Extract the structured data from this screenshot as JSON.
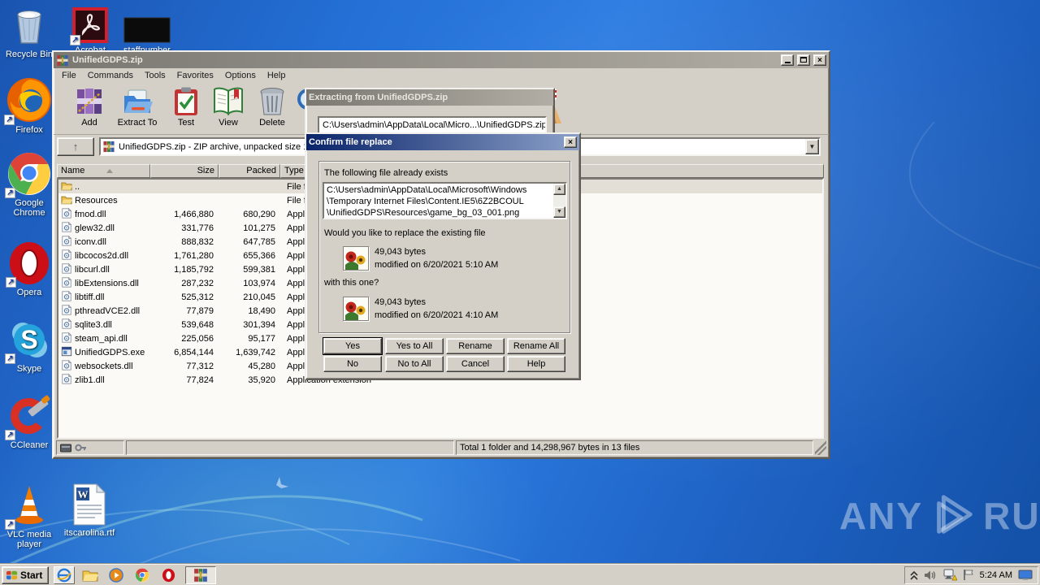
{
  "colors": {
    "desktop_blue": "#2470d6",
    "classic_gray": "#d4d0c8",
    "active_title_start": "#0a246a",
    "active_title_end": "#8ba0c8",
    "inactive_title_start": "#7b7872",
    "inactive_title_end": "#b2aea5"
  },
  "desktop": {
    "icons": {
      "recycle_bin": "Recycle Bin",
      "acrobat": "Acrobat",
      "staffnumber": "staffnumber",
      "firefox": "Firefox",
      "chrome": "Google Chrome",
      "opera": "Opera",
      "skype": "Skype",
      "ccleaner": "CCleaner",
      "vlc": "VLC media player",
      "rtf": "itscarolina.rtf"
    },
    "watermark": {
      "left": "ANY",
      "right": "RUN"
    }
  },
  "winrar": {
    "title": "UnifiedGDPS.zip",
    "window_buttons": [
      "minimize",
      "maximize",
      "close"
    ],
    "menu": [
      "File",
      "Commands",
      "Tools",
      "Favorites",
      "Options",
      "Help"
    ],
    "toolbar": [
      "Add",
      "Extract To",
      "Test",
      "View",
      "Delete"
    ],
    "address": "UnifiedGDPS.zip - ZIP archive, unpacked size 18",
    "columns": {
      "name": "Name",
      "size": "Size",
      "packed": "Packed",
      "type": "Type"
    },
    "rows": [
      {
        "icon": "folder",
        "name": "..",
        "size": "",
        "packed": "",
        "type": "File folder",
        "up": true
      },
      {
        "icon": "folder",
        "name": "Resources",
        "size": "",
        "packed": "",
        "type": "File folder"
      },
      {
        "icon": "dll",
        "name": "fmod.dll",
        "size": "1,466,880",
        "packed": "680,290",
        "type": "Application extension"
      },
      {
        "icon": "dll",
        "name": "glew32.dll",
        "size": "331,776",
        "packed": "101,275",
        "type": "Application extension"
      },
      {
        "icon": "dll",
        "name": "iconv.dll",
        "size": "888,832",
        "packed": "647,785",
        "type": "Application extension"
      },
      {
        "icon": "dll",
        "name": "libcocos2d.dll",
        "size": "1,761,280",
        "packed": "655,366",
        "type": "Application extension"
      },
      {
        "icon": "dll",
        "name": "libcurl.dll",
        "size": "1,185,792",
        "packed": "599,381",
        "type": "Application extension"
      },
      {
        "icon": "dll",
        "name": "libExtensions.dll",
        "size": "287,232",
        "packed": "103,974",
        "type": "Application extension"
      },
      {
        "icon": "dll",
        "name": "libtiff.dll",
        "size": "525,312",
        "packed": "210,045",
        "type": "Application extension"
      },
      {
        "icon": "dll",
        "name": "pthreadVCE2.dll",
        "size": "77,879",
        "packed": "18,490",
        "type": "Application extension"
      },
      {
        "icon": "dll",
        "name": "sqlite3.dll",
        "size": "539,648",
        "packed": "301,394",
        "type": "Application extension"
      },
      {
        "icon": "dll",
        "name": "steam_api.dll",
        "size": "225,056",
        "packed": "95,177",
        "type": "Application extension"
      },
      {
        "icon": "exe",
        "name": "UnifiedGDPS.exe",
        "size": "6,854,144",
        "packed": "1,639,742",
        "type": "Application"
      },
      {
        "icon": "dll",
        "name": "websockets.dll",
        "size": "77,312",
        "packed": "45,280",
        "type": "Application extension"
      },
      {
        "icon": "dll",
        "name": "zlib1.dll",
        "size": "77,824",
        "packed": "35,920",
        "type": "Application extension"
      }
    ],
    "status_total": "Total 1 folder and 14,298,967 bytes in 13 files"
  },
  "extract_dialog": {
    "title": "Extracting from UnifiedGDPS.zip",
    "path": "C:\\Users\\admin\\AppData\\Local\\Micro...\\UnifiedGDPS.zip"
  },
  "confirm_dialog": {
    "title": "Confirm file replace",
    "exists_label": "The following file already exists",
    "path_line1": "C:\\Users\\admin\\AppData\\Local\\Microsoft\\Windows",
    "path_line2": "\\Temporary Internet Files\\Content.IE5\\6Z2BCOUL",
    "path_line3": "\\UnifiedGDPS\\Resources\\game_bg_03_001.png",
    "question": "Would you like to replace the existing file",
    "existing": {
      "size": "49,043 bytes",
      "modified": "modified on 6/20/2021 5:10 AM"
    },
    "with_label": "with this one?",
    "replacement": {
      "size": "49,043 bytes",
      "modified": "modified on 6/20/2021 4:10 AM"
    },
    "buttons": [
      "Yes",
      "Yes to All",
      "Rename",
      "Rename All",
      "No",
      "No to All",
      "Cancel",
      "Help"
    ]
  },
  "taskbar": {
    "start_label": "Start",
    "quick_launch": [
      "internet-explorer",
      "windows-explorer",
      "media-player",
      "chrome",
      "opera"
    ],
    "task_button": "winrar",
    "tray_icons": [
      "hidden-icons-chevron",
      "volume",
      "network-warning",
      "action-center-flag"
    ],
    "clock": "5:24 AM"
  }
}
